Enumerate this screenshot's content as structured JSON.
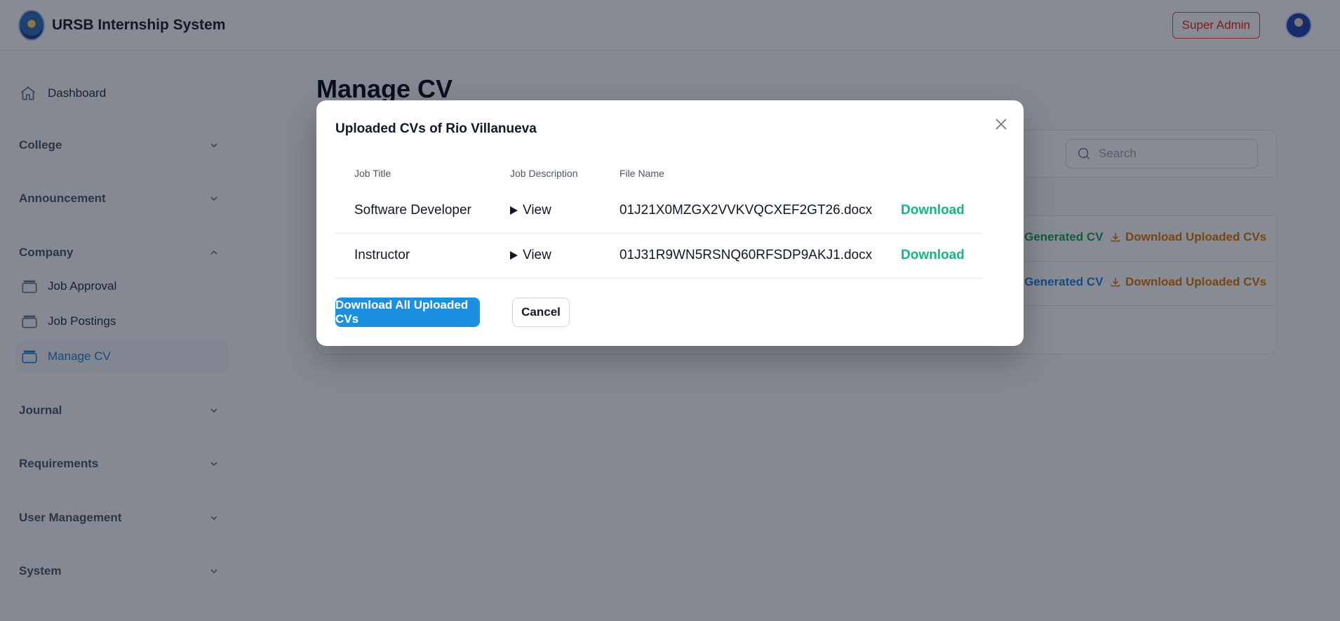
{
  "app": {
    "title": "URSB Internship System",
    "role": "Super Admin"
  },
  "sidebar": {
    "dashboard": "Dashboard",
    "groups": {
      "college": "College",
      "announcement": "Announcement",
      "company": "Company",
      "journal": "Journal",
      "requirements": "Requirements",
      "user_management": "User Management",
      "system": "System"
    },
    "company_items": [
      "Job Approval",
      "Job Postings",
      "Manage CV"
    ],
    "active_item": "Manage CV"
  },
  "main": {
    "title": "Manage CV",
    "search_placeholder": "Search",
    "rows": [
      {
        "generated": "Generated CV",
        "uploaded": "Download Uploaded CVs"
      },
      {
        "generated": "Generated CV",
        "uploaded": "Download Uploaded CVs"
      }
    ]
  },
  "modal": {
    "title": "Uploaded CVs of Rio Villanueva",
    "columns": [
      "Job Title",
      "Job Description",
      "File Name"
    ],
    "rows": [
      {
        "job_title": "Software Developer",
        "description": "View",
        "file_name": "01J21X0MZGX2VVKVQCXEF2GT26.docx",
        "action": "Download"
      },
      {
        "job_title": "Instructor",
        "description": "View",
        "file_name": "01J31R9WN5RSNQ60RFSDP9AKJ1.docx",
        "action": "Download"
      }
    ],
    "download_all_label": "Download All Uploaded CVs",
    "cancel_label": "Cancel"
  },
  "colors": {
    "primary": "#1d8fe0",
    "download_green": "#10b981",
    "badge_red": "#dc2626",
    "active_blue": "#1d7fd8"
  }
}
